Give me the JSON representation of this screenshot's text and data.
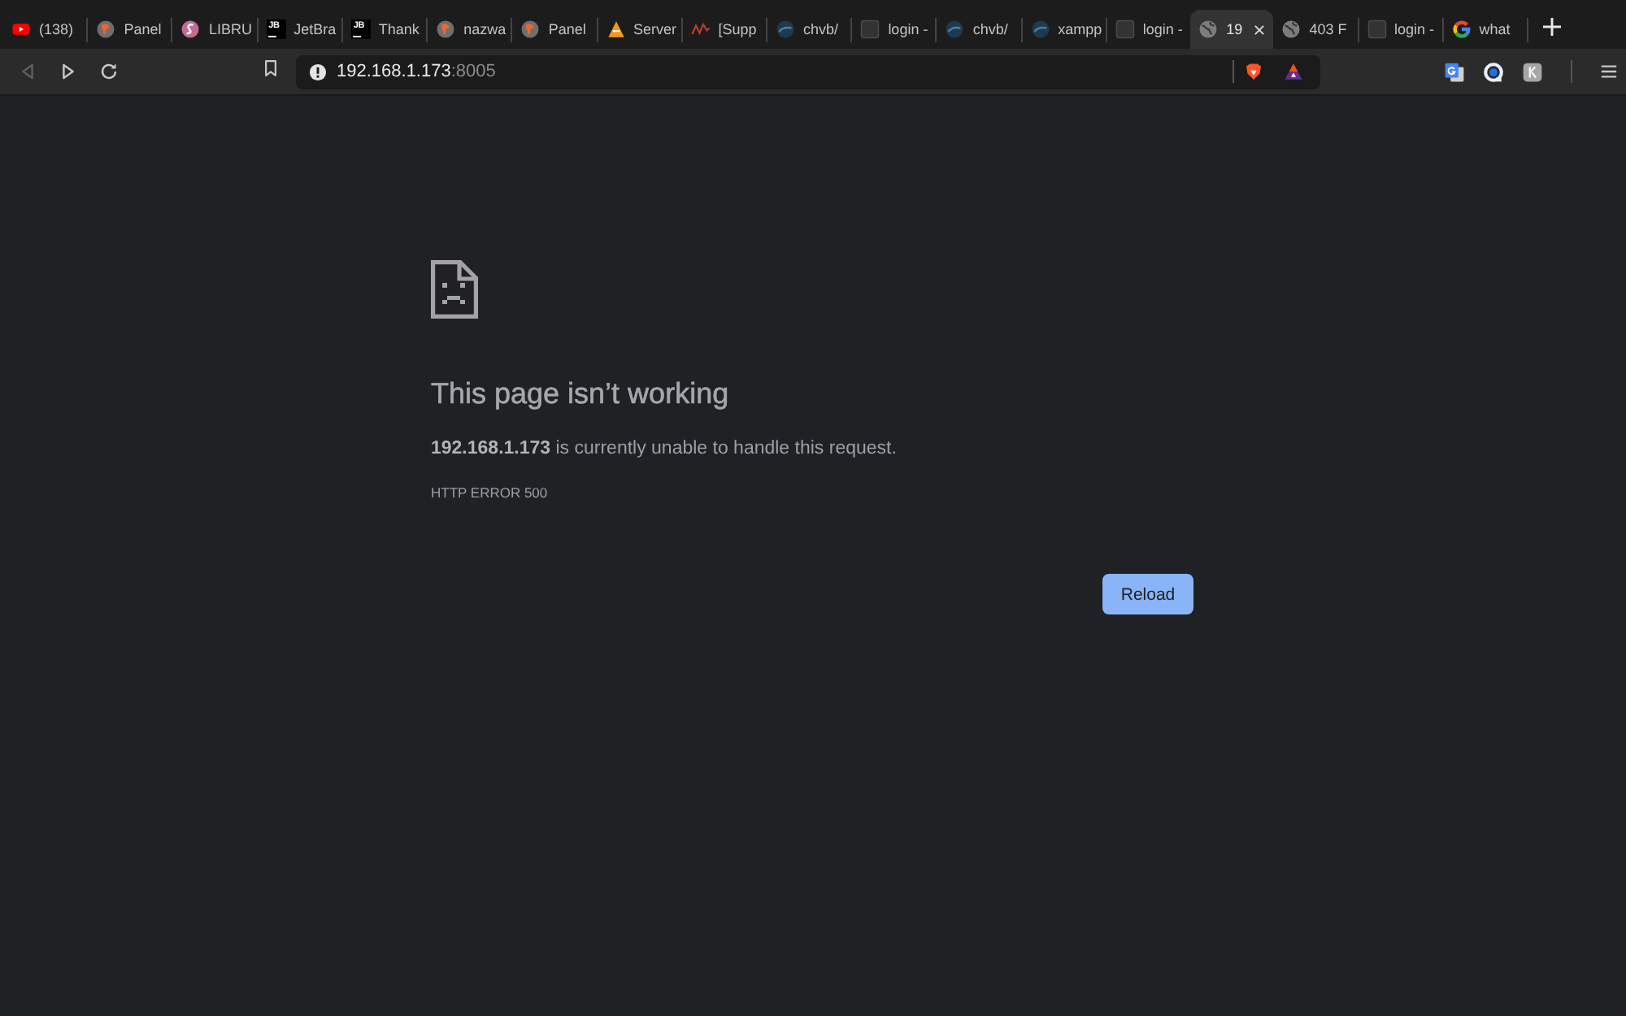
{
  "tabs": [
    {
      "title": "(138)",
      "kind": "youtube",
      "selected": false
    },
    {
      "title": "Panel",
      "kind": "fox",
      "selected": false
    },
    {
      "title": "LIBRU",
      "kind": "swirl",
      "selected": false
    },
    {
      "title": "JetBra",
      "kind": "letters",
      "logo_text": "JB",
      "selected": false
    },
    {
      "title": "Thank",
      "kind": "letters",
      "logo_text": "JB",
      "selected": false
    },
    {
      "title": "nazwa",
      "kind": "fox",
      "selected": false
    },
    {
      "title": "Panel",
      "kind": "fox",
      "selected": false
    },
    {
      "title": "Server",
      "kind": "cone",
      "selected": false
    },
    {
      "title": "[Supp",
      "kind": "wave",
      "selected": false
    },
    {
      "title": "chvb/",
      "kind": "disc",
      "selected": false
    },
    {
      "title": "login -",
      "kind": "square",
      "selected": false
    },
    {
      "title": "chvb/",
      "kind": "disc",
      "selected": false
    },
    {
      "title": "xampp",
      "kind": "disc",
      "selected": false
    },
    {
      "title": "login -",
      "kind": "square",
      "selected": false
    },
    {
      "title": "19",
      "kind": "globe",
      "selected": true
    },
    {
      "title": "403 F",
      "kind": "globe",
      "selected": false
    },
    {
      "title": "login -",
      "kind": "square",
      "selected": false
    },
    {
      "title": "what",
      "kind": "ring",
      "selected": false
    }
  ],
  "toolbar": {
    "back": {
      "disabled": true
    },
    "forward": {
      "disabled": false
    },
    "address": {
      "host": "192.168.1.173",
      "port": ":8005"
    }
  },
  "error": {
    "heading": "This page isn’t working",
    "message": "**192.168.1.173** is currently unable to handle this request.",
    "code": "HTTP ERROR 500",
    "button": "Reload"
  }
}
